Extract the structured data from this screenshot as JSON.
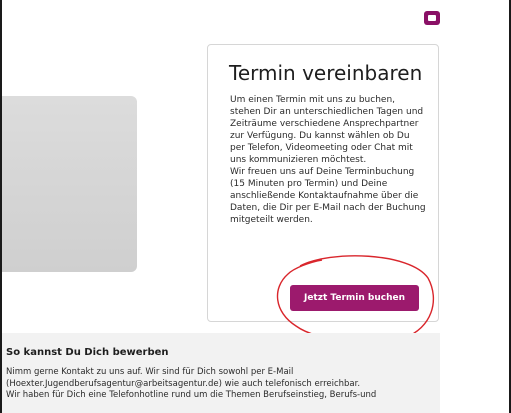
{
  "header": {
    "youtube_icon": "youtube-icon",
    "icon_color": "#8a1066"
  },
  "booking": {
    "title": "Termin vereinbaren",
    "paragraph_1": "Um einen Termin mit uns zu buchen, stehen Dir an unterschiedlichen Tagen und Zeiträume verschiedene Ansprechpartner zur Verfügung. Du kannst wählen ob Du per Telefon, Videomeeting oder Chat mit uns kommunizieren möchtest.",
    "paragraph_2": "Wir freuen uns auf Deine Terminbuchung (15 Minuten pro Termin) und Deine anschließende Kontaktaufnahme über die Daten, die Dir per E-Mail nach der Buchung mitgeteilt werden.",
    "button_label": "Jetzt Termin buchen",
    "button_color": "#9c1a6d"
  },
  "apply": {
    "heading": "So kannst Du Dich bewerben",
    "line_1": "Nimm gerne Kontakt zu uns auf. Wir sind für Dich sowohl per E-Mail",
    "line_2": "(Hoexter.Jugendberufsagentur@arbeitsagentur.de) wie auch telefonisch erreichbar.",
    "line_3": "Wir haben für Dich eine Telefonhotline rund um die Themen Berufseinstieg, Berufs-und"
  },
  "annotation": {
    "color": "#d9262c"
  }
}
